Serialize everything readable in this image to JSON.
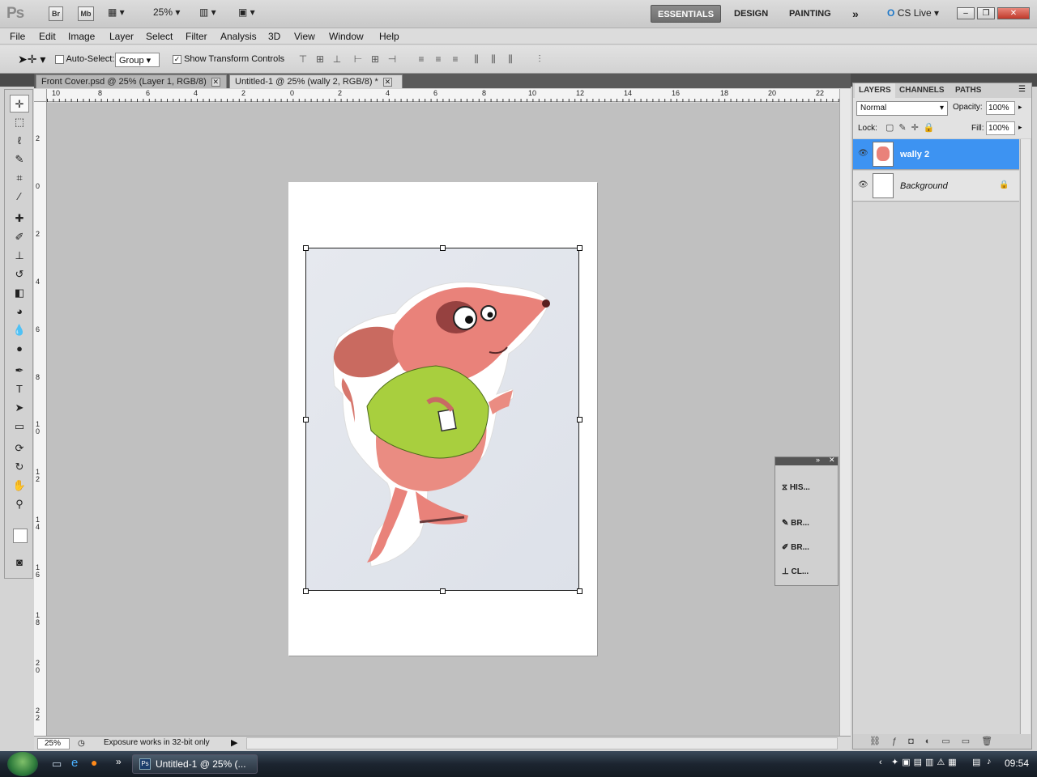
{
  "appbar": {
    "logo": "Ps",
    "bridge": "Br",
    "minibridge": "Mb",
    "zoom": "25%",
    "workspaces": [
      "ESSENTIALS",
      "DESIGN",
      "PAINTING"
    ],
    "more": "»",
    "cslive": "CS Live"
  },
  "menu": [
    "File",
    "Edit",
    "Image",
    "Layer",
    "Select",
    "Filter",
    "Analysis",
    "3D",
    "View",
    "Window",
    "Help"
  ],
  "options": {
    "autoselect_label": "Auto-Select:",
    "autoselect_value": "Group",
    "transform_label": "Show Transform Controls"
  },
  "tabs": [
    {
      "label": "Front Cover.psd @ 25% (Layer 1, RGB/8)"
    },
    {
      "label": "Untitled-1 @ 25% (wally 2, RGB/8) *"
    }
  ],
  "ruler_h": [
    "10",
    "8",
    "6",
    "4",
    "2",
    "0",
    "2",
    "4",
    "6",
    "8",
    "10",
    "12",
    "14",
    "16",
    "18",
    "20",
    "22"
  ],
  "ruler_v": [
    "2",
    "0",
    "2",
    "4",
    "6",
    "8",
    "1\n0",
    "1\n2",
    "1\n4",
    "1\n6",
    "1\n8",
    "2\n0",
    "2\n2"
  ],
  "status": {
    "zoom": "25%",
    "message": "Exposure works in 32-bit only"
  },
  "layers_panel": {
    "tabs": [
      "LAYERS",
      "CHANNELS",
      "PATHS"
    ],
    "blend_mode": "Normal",
    "opacity_label": "Opacity:",
    "opacity": "100%",
    "lock_label": "Lock:",
    "fill_label": "Fill:",
    "fill": "100%",
    "layers": [
      {
        "name": "wally 2",
        "selected": true
      },
      {
        "name": "Background",
        "selected": false,
        "locked": true
      }
    ]
  },
  "float_panel": {
    "items": [
      "HIS...",
      "BR...",
      "BR...",
      "CL..."
    ]
  },
  "taskbar": {
    "task": "Untitled-1 @ 25% (...",
    "time": "09:54"
  },
  "colors": {
    "accent": "#3d93f2",
    "canvas_bg": "#c0c0c0"
  }
}
